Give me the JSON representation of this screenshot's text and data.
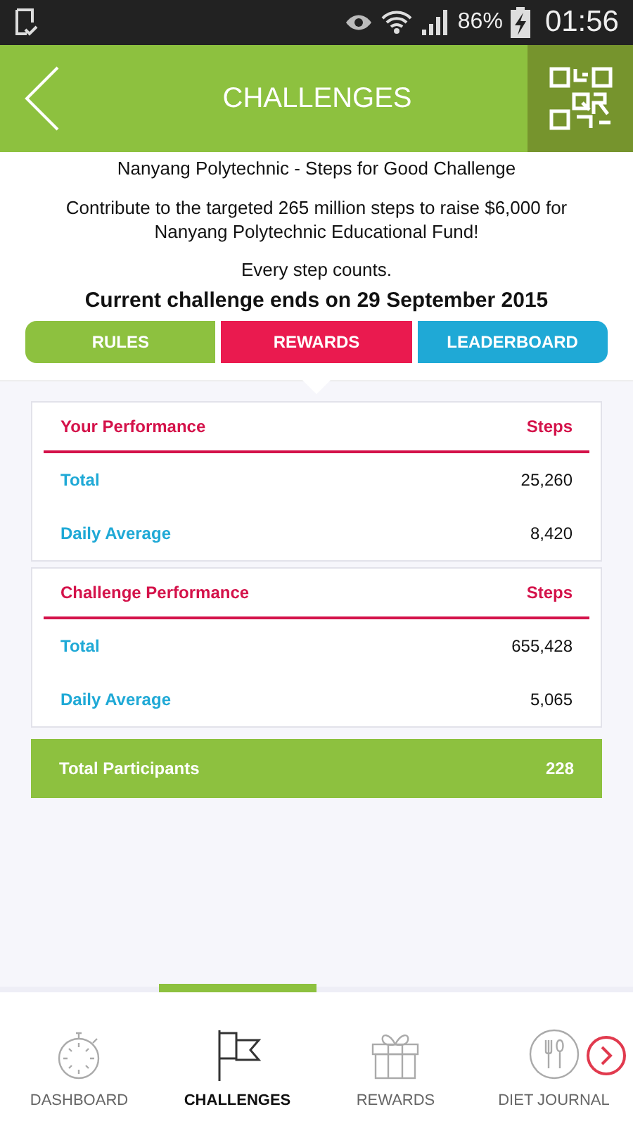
{
  "status_bar": {
    "battery": "86%",
    "time": "01:56"
  },
  "header": {
    "title": "CHALLENGES"
  },
  "intro": {
    "name": "Nanyang Polytechnic - Steps for Good Challenge",
    "description": "Contribute to the targeted 265 million steps to raise $6,000 for Nanyang Polytechnic Educational Fund!",
    "motto": "Every step counts.",
    "deadline": "Current challenge ends on 29 September 2015"
  },
  "tabs": [
    {
      "label": "RULES",
      "color": "#8dc13f"
    },
    {
      "label": "REWARDS",
      "color": "#ea1a4f"
    },
    {
      "label": "LEADERBOARD",
      "color": "#1fa9d6"
    }
  ],
  "cards": [
    {
      "title": "Your Performance",
      "unit": "Steps",
      "rows": [
        {
          "label": "Total",
          "value": "25,260"
        },
        {
          "label": "Daily Average",
          "value": "8,420"
        }
      ]
    },
    {
      "title": "Challenge Performance",
      "unit": "Steps",
      "rows": [
        {
          "label": "Total",
          "value": "655,428"
        },
        {
          "label": "Daily Average",
          "value": "5,065"
        }
      ]
    }
  ],
  "participants": {
    "label": "Total Participants",
    "value": "228"
  },
  "bottom_nav": [
    {
      "label": "DASHBOARD",
      "kind": "stopwatch",
      "selected": false
    },
    {
      "label": "CHALLENGES",
      "kind": "flag",
      "selected": true
    },
    {
      "label": "REWARDS",
      "kind": "gift",
      "selected": false
    },
    {
      "label": "DIET JOURNAL",
      "kind": "cutlery",
      "selected": false
    }
  ]
}
